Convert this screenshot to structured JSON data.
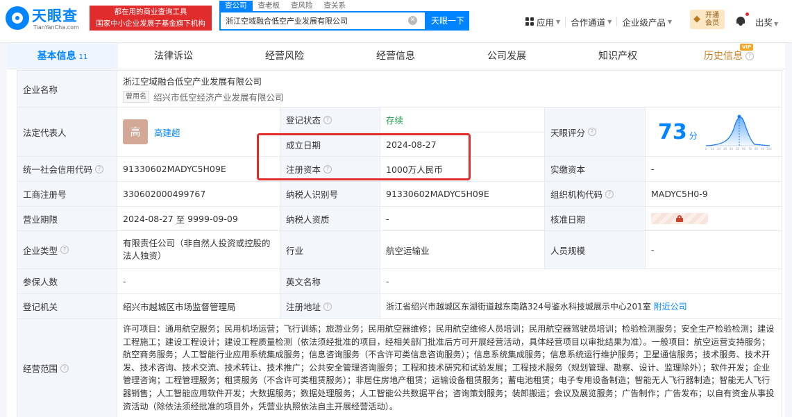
{
  "brand": {
    "name": "天眼查",
    "domain": "TianYanCha.com",
    "color": "#0084ff"
  },
  "promo": {
    "line1": "都在用的商业查询工具",
    "line2": "国家中小企业发展子基金旗下机构"
  },
  "search": {
    "tabs": [
      "查公司",
      "查老板",
      "查风险",
      "查关系"
    ],
    "active_tab": "查公司",
    "value": "浙江空域融合低空产业发展有限公司",
    "button": "天眼一下"
  },
  "header_nav": {
    "apps": "应用",
    "partner": "合作通道",
    "enterprise": "企业级产品",
    "vip_line1": "开通",
    "vip_line2": "会员",
    "exit": "出奖"
  },
  "tabs": [
    {
      "label": "基本信息",
      "count": "11"
    },
    {
      "label": "法律诉讼"
    },
    {
      "label": "经营风险"
    },
    {
      "label": "经营信息"
    },
    {
      "label": "公司发展"
    },
    {
      "label": "知识产权"
    },
    {
      "label": "历史信息",
      "tag": "VIP"
    }
  ],
  "info": {
    "company_name_label": "企业名称",
    "company_name": "浙江空域融合低空产业发展有限公司",
    "used_name_tag": "曾用名",
    "used_name": "绍兴市低空经济产业发展有限公司",
    "legal_rep_label": "法定代表人",
    "legal_rep_avatar": "高",
    "legal_rep": "高建超",
    "reg_status_label": "登记状态",
    "reg_status": "存续",
    "score_label": "天眼评分",
    "score": "73",
    "score_unit": "分",
    "found_date_label": "成立日期",
    "found_date": "2024-08-27",
    "reg_capital_label": "注册资本",
    "reg_capital": "1000万人民币",
    "paid_capital_label": "实缴资本",
    "paid_capital": "-",
    "credit_code_label": "统一社会信用代码",
    "credit_code": "91330602MADYC5H09E",
    "biz_reg_no_label": "工商注册号",
    "biz_reg_no": "330602000499767",
    "taxpayer_id_label": "纳税人识别号",
    "taxpayer_id": "91330602MADYC5H09E",
    "org_code_label": "组织机构代码",
    "org_code": "MADYC5H0-9",
    "term_label": "营业期限",
    "term_start": "2024-08-27",
    "term_to": "至",
    "term_end": "9999-09-09",
    "taxpayer_qual_label": "纳税人资质",
    "taxpayer_qual": "-",
    "approval_date_label": "核准日期",
    "type_label": "企业类型",
    "type_line1": "有限责任公司（非自然人投资或控股的",
    "type_line2": "法人独资）",
    "industry_label": "行业",
    "industry": "航空运输业",
    "staff_size_label": "人员规模",
    "staff_size": "-",
    "insured_label": "参保人数",
    "insured": "-",
    "english_name_label": "英文名称",
    "english_name": "-",
    "authority_label": "登记机关",
    "authority": "绍兴市越城区市场监督管理局",
    "address_label": "注册地址",
    "address": "浙江省绍兴市越城区东湖街道越东南路324号鉴水科技城展示中心201室",
    "nearby": "附近公司",
    "scope_label": "经营范围",
    "scope": "许可项目：通用航空服务；民用机场运营；飞行训练；旅游业务；民用航空器维修；民用航空维修人员培训；民用航空器驾驶员培训；检验检测服务；安全生产检验检测；建设工程施工；建设工程设计；建设工程质量检测（依法须经批准的项目，经相关部门批准后方可开展经营活动，具体经营项目以审批结果为准）。一般项目：航空运营支持服务；航空商务服务；人工智能行业应用系统集成服务；信息咨询服务（不含许可类信息咨询服务）；信息系统集成服务；信息系统运行维护服务；卫星通信服务；技术服务、技术开发、技术咨询、技术交流、技术转让、技术推广；公共安全管理咨询服务；工程和技术研究和试验发展；工程技术服务（规划管理、勘察、设计、监理除外）；软件开发；企业管理咨询；工程管理服务；租赁服务（不含许可类租赁服务）；非居住房地产租赁；运输设备租赁服务；蓄电池租赁；电子专用设备制造；智能无人飞行器制造；智能无人飞行器销售；人工智能应用软件开发；大数据服务；数据处理服务；人工智能公共数据平台；咨询策划服务；装卸搬运；会议及展览服务；广告制作；广告发布；以自有资金从事投资活动（除依法须经批准的项目外，凭营业执照依法自主开展经营活动）。"
  },
  "colors": {
    "accent": "#0084ff",
    "highlight": "#e22b2b",
    "status_green": "#1c9c4a",
    "label_bg": "#f3f6fb"
  }
}
